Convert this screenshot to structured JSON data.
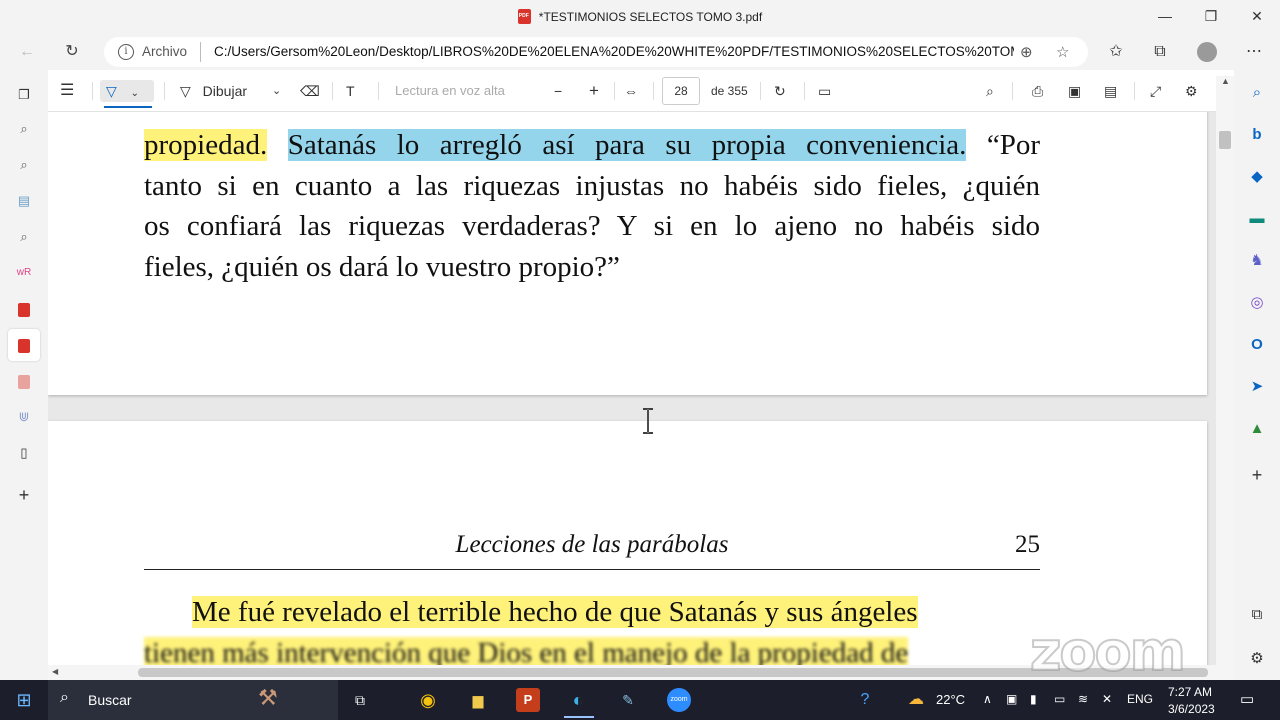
{
  "window": {
    "title": "*TESTIMONIOS SELECTOS TOMO 3.pdf",
    "minimize": "—",
    "maximize": "❐",
    "close": "✕"
  },
  "address_bar": {
    "site_label": "Archivo",
    "url": "C:/Users/Gersom%20Leon/Desktop/LIBROS%20DE%20ELENA%20DE%20WHITE%20PDF/TESTIMONIOS%20SELECTOS%20TOM..."
  },
  "pdf_toolbar": {
    "draw_label": "Dibujar",
    "read_aloud_label": "Lectura en voz alta",
    "current_page": "28",
    "total_pages": "de 355"
  },
  "page1": {
    "lines": [
      {
        "parts": [
          {
            "text": "propiedad.",
            "hl": "yellow"
          },
          {
            "text": " ",
            "hl": ""
          },
          {
            "text": "Satanás lo arregló así para su propia conveniencia.",
            "hl": "blue"
          },
          {
            "text": " “Por",
            "hl": ""
          }
        ]
      },
      {
        "parts": [
          {
            "text": "tanto si en cuanto a las riquezas injustas no habéis sido fieles, ¿quién",
            "hl": ""
          }
        ]
      },
      {
        "parts": [
          {
            "text": "os confiará las riquezas verdaderas? Y si en lo ajeno no habéis sido",
            "hl": ""
          }
        ]
      },
      {
        "parts": [
          {
            "text": "fieles, ¿quién os dará lo vuestro propio?”",
            "hl": ""
          }
        ]
      }
    ]
  },
  "page2": {
    "running_head": "Lecciones de las parábolas",
    "page_number": "25",
    "lines": [
      {
        "parts": [
          {
            "text": "Me fué revelado el terrible hecho de que Satanás y sus ángeles",
            "hl": "yellow"
          }
        ]
      },
      {
        "parts": [
          {
            "text": "tienen más intervención que Dios en el manejo de la propiedad de",
            "hl": "yellow"
          }
        ]
      }
    ]
  },
  "watermark": "zoom",
  "taskbar": {
    "search_label": "Buscar",
    "weather": "22°C",
    "language": "ENG",
    "time": "7:27 AM",
    "date": "3/6/2023"
  },
  "colors": {
    "highlight_yellow": "#fff27a",
    "highlight_blue": "#94d5ec",
    "edge_blue": "#0a66c2"
  }
}
